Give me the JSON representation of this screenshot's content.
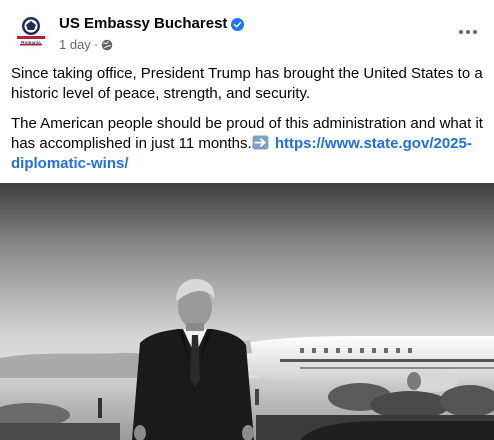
{
  "post": {
    "page_name": "US Embassy Bucharest",
    "avatar_caption": "Romania",
    "time": "1 day",
    "separator": "·",
    "privacy_icon": "globe-icon",
    "verified_icon": "verified-badge-icon",
    "more_icon": "more-options-icon",
    "paragraph_1": "Since taking office, President Trump has brought the United States to a historic level of peace, strength, and security.",
    "paragraph_2": "The American people should be proud of this administration and what it has accomplished in just 11 months.",
    "arrow_icon": "right-arrow-emoji-icon",
    "link_text": "https://www.state.gov/2025-diplomatic-wins/",
    "photo": "black-and-white photo of a man in a dark suit walking in front of an airplane"
  },
  "colors": {
    "text": "#050505",
    "meta": "#65676b",
    "link": "#216fdb",
    "verified": "#1877f2"
  }
}
